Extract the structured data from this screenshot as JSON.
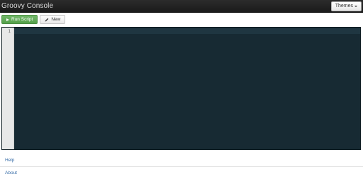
{
  "app": {
    "title": "Groovy Console"
  },
  "navbar": {
    "themes_label": "Themes"
  },
  "toolbar": {
    "run_label": "Run Script",
    "new_label": "New"
  },
  "editor": {
    "line_numbers": [
      "1"
    ],
    "content": ""
  },
  "footer": {
    "links": [
      {
        "label": "Help"
      },
      {
        "label": "About"
      }
    ]
  },
  "colors": {
    "navbar_bg": "#1b1b1b",
    "run_button": "#5cb85c",
    "editor_bg": "#172a33",
    "link": "#3a6ea8"
  }
}
